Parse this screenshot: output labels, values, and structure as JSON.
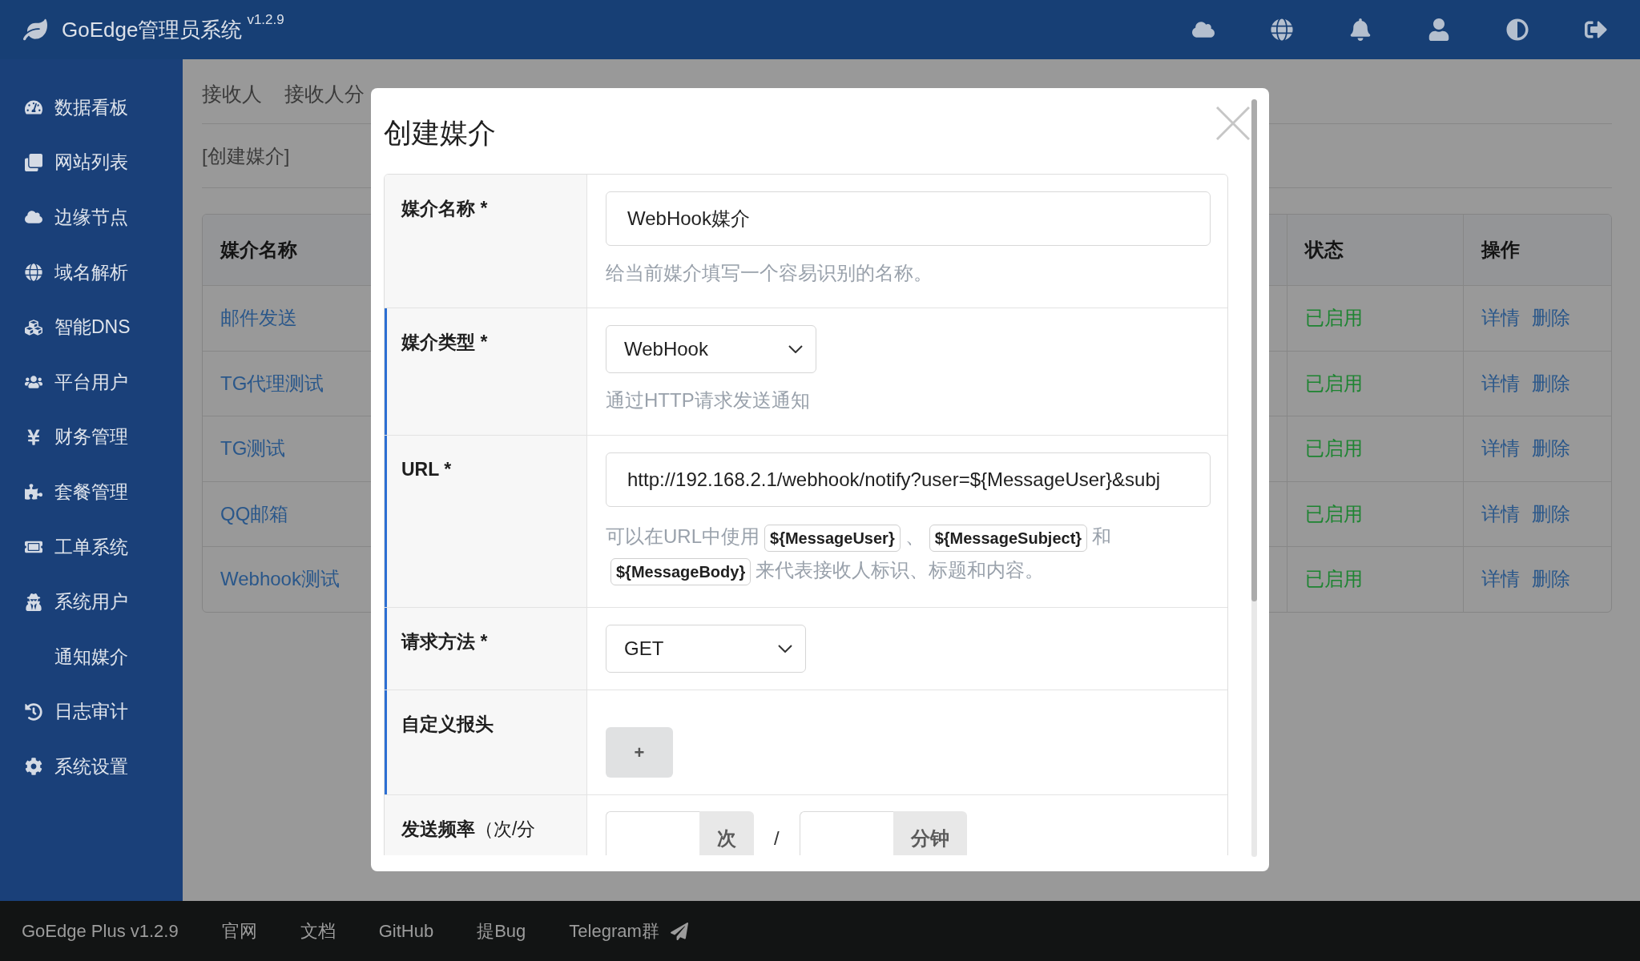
{
  "topbar": {
    "title": "GoEdge管理员系统",
    "version": "v1.2.9"
  },
  "sidebar": {
    "items": [
      {
        "label": "数据看板",
        "kind": "icon"
      },
      {
        "label": "网站列表",
        "kind": "icon"
      },
      {
        "label": "边缘节点",
        "kind": "icon"
      },
      {
        "label": "域名解析",
        "kind": "icon"
      },
      {
        "label": "智能DNS",
        "kind": "icon"
      },
      {
        "label": "平台用户",
        "kind": "icon"
      },
      {
        "label": "财务管理",
        "kind": "icon"
      },
      {
        "label": "套餐管理",
        "kind": "icon"
      },
      {
        "label": "工单系统",
        "kind": "icon"
      },
      {
        "label": "系统用户",
        "kind": "icon"
      },
      {
        "label": "通知媒介",
        "kind": "plain"
      },
      {
        "label": "日志审计",
        "kind": "icon"
      },
      {
        "label": "系统设置",
        "kind": "icon"
      }
    ]
  },
  "tabs": [
    {
      "label": "接收人",
      "selected": false
    },
    {
      "label": "接收人分",
      "selected": false
    }
  ],
  "create_link": "[创建媒介]",
  "table": {
    "columns": [
      "媒介名称",
      "状态",
      "操作"
    ],
    "rows": [
      {
        "name": "邮件发送",
        "status": "已启用",
        "actions": [
          "详情",
          "删除"
        ]
      },
      {
        "name": "TG代理测试",
        "status": "已启用",
        "actions": [
          "详情",
          "删除"
        ]
      },
      {
        "name": "TG测试",
        "status": "已启用",
        "actions": [
          "详情",
          "删除"
        ]
      },
      {
        "name": "QQ邮箱",
        "status": "已启用",
        "actions": [
          "详情",
          "删除"
        ]
      },
      {
        "name": "Webhook测试",
        "status": "已启用",
        "actions": [
          "详情",
          "删除"
        ]
      }
    ]
  },
  "dialog": {
    "title": "创建媒介",
    "fields": [
      {
        "kind": "text",
        "label": "媒介名称 *",
        "marked": false,
        "value": "WebHook媒介",
        "help": [
          {
            "kind": "text",
            "text": "给当前媒介填写一个容易识别的名称。"
          }
        ]
      },
      {
        "kind": "select",
        "label": "媒介类型 *",
        "marked": true,
        "value": "WebHook",
        "help": [
          {
            "kind": "text",
            "text": "通过HTTP请求发送通知"
          }
        ]
      },
      {
        "kind": "text",
        "label": "URL *",
        "marked": true,
        "value": "http://192.168.2.1/webhook/notify?user=${MessageUser}&subj",
        "help": [
          {
            "kind": "text",
            "text": "可以在URL中使用"
          },
          {
            "kind": "code",
            "text": "${MessageUser}"
          },
          {
            "kind": "text",
            "text": "、"
          },
          {
            "kind": "code",
            "text": "${MessageSubject}"
          },
          {
            "kind": "text",
            "text": "和"
          },
          {
            "kind": "code",
            "text": "${MessageBody}"
          },
          {
            "kind": "text",
            "text": "来代表接收人标识、标题和内容。"
          }
        ]
      },
      {
        "kind": "select",
        "label": "请求方法 *",
        "marked": true,
        "value": "GET"
      },
      {
        "kind": "button",
        "label": "自定义报头",
        "marked": true,
        "button": "+"
      },
      {
        "kind": "rate",
        "label": "**发送频率**（次/分",
        "marked": false,
        "units": [
          "次",
          "分钟"
        ],
        "separator": "/"
      }
    ]
  },
  "footer": {
    "version": "GoEdge Plus v1.2.9",
    "links": [
      {
        "label": "官网",
        "kind": "plain"
      },
      {
        "label": "文档",
        "kind": "plain"
      },
      {
        "label": "GitHub",
        "kind": "plain"
      },
      {
        "label": "提Bug",
        "kind": "plain"
      },
      {
        "label": "Telegram群",
        "kind": "chat"
      }
    ]
  }
}
